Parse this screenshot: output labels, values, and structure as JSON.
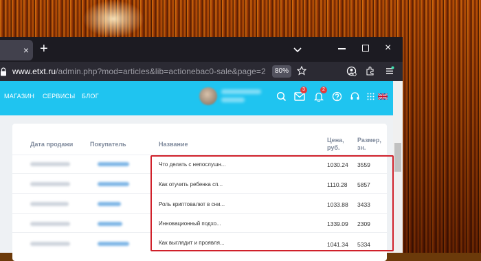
{
  "browser": {
    "new_tab": "+",
    "tab_close": "×",
    "url_domain": "www.etxt.ru",
    "url_path": "/admin.php?mod=articles&lib=actionebac0-sale&page=2",
    "zoom": "80%",
    "window_close": "×"
  },
  "site": {
    "menu": [
      "МАГАЗИН",
      "СЕРВИСЫ",
      "БЛОГ"
    ],
    "messages_badge": "3",
    "notifications_badge": "2"
  },
  "table": {
    "headers": {
      "date": "Дата продажи",
      "buyer": "Покупатель",
      "title": "Название",
      "price_l1": "Цена,",
      "price_l2": "руб.",
      "size_l1": "Размер,",
      "size_l2": "зн."
    },
    "rows": [
      {
        "title": "Что делать с непослушн...",
        "price": "1030.24",
        "size": "3559"
      },
      {
        "title": "Как отучить ребенка сп...",
        "price": "1110.28",
        "size": "5857"
      },
      {
        "title": "Роль криптовалют в сни...",
        "price": "1033.88",
        "size": "3433"
      },
      {
        "title": "Инновационный подхо...",
        "price": "1339.09",
        "size": "2309"
      },
      {
        "title": "Как выглядит и проявля...",
        "price": "1041.34",
        "size": "5334"
      }
    ]
  },
  "colors": {
    "header_bg": "#1fc4f0",
    "highlight_border": "#d0202a",
    "badge": "#e53a3a"
  }
}
